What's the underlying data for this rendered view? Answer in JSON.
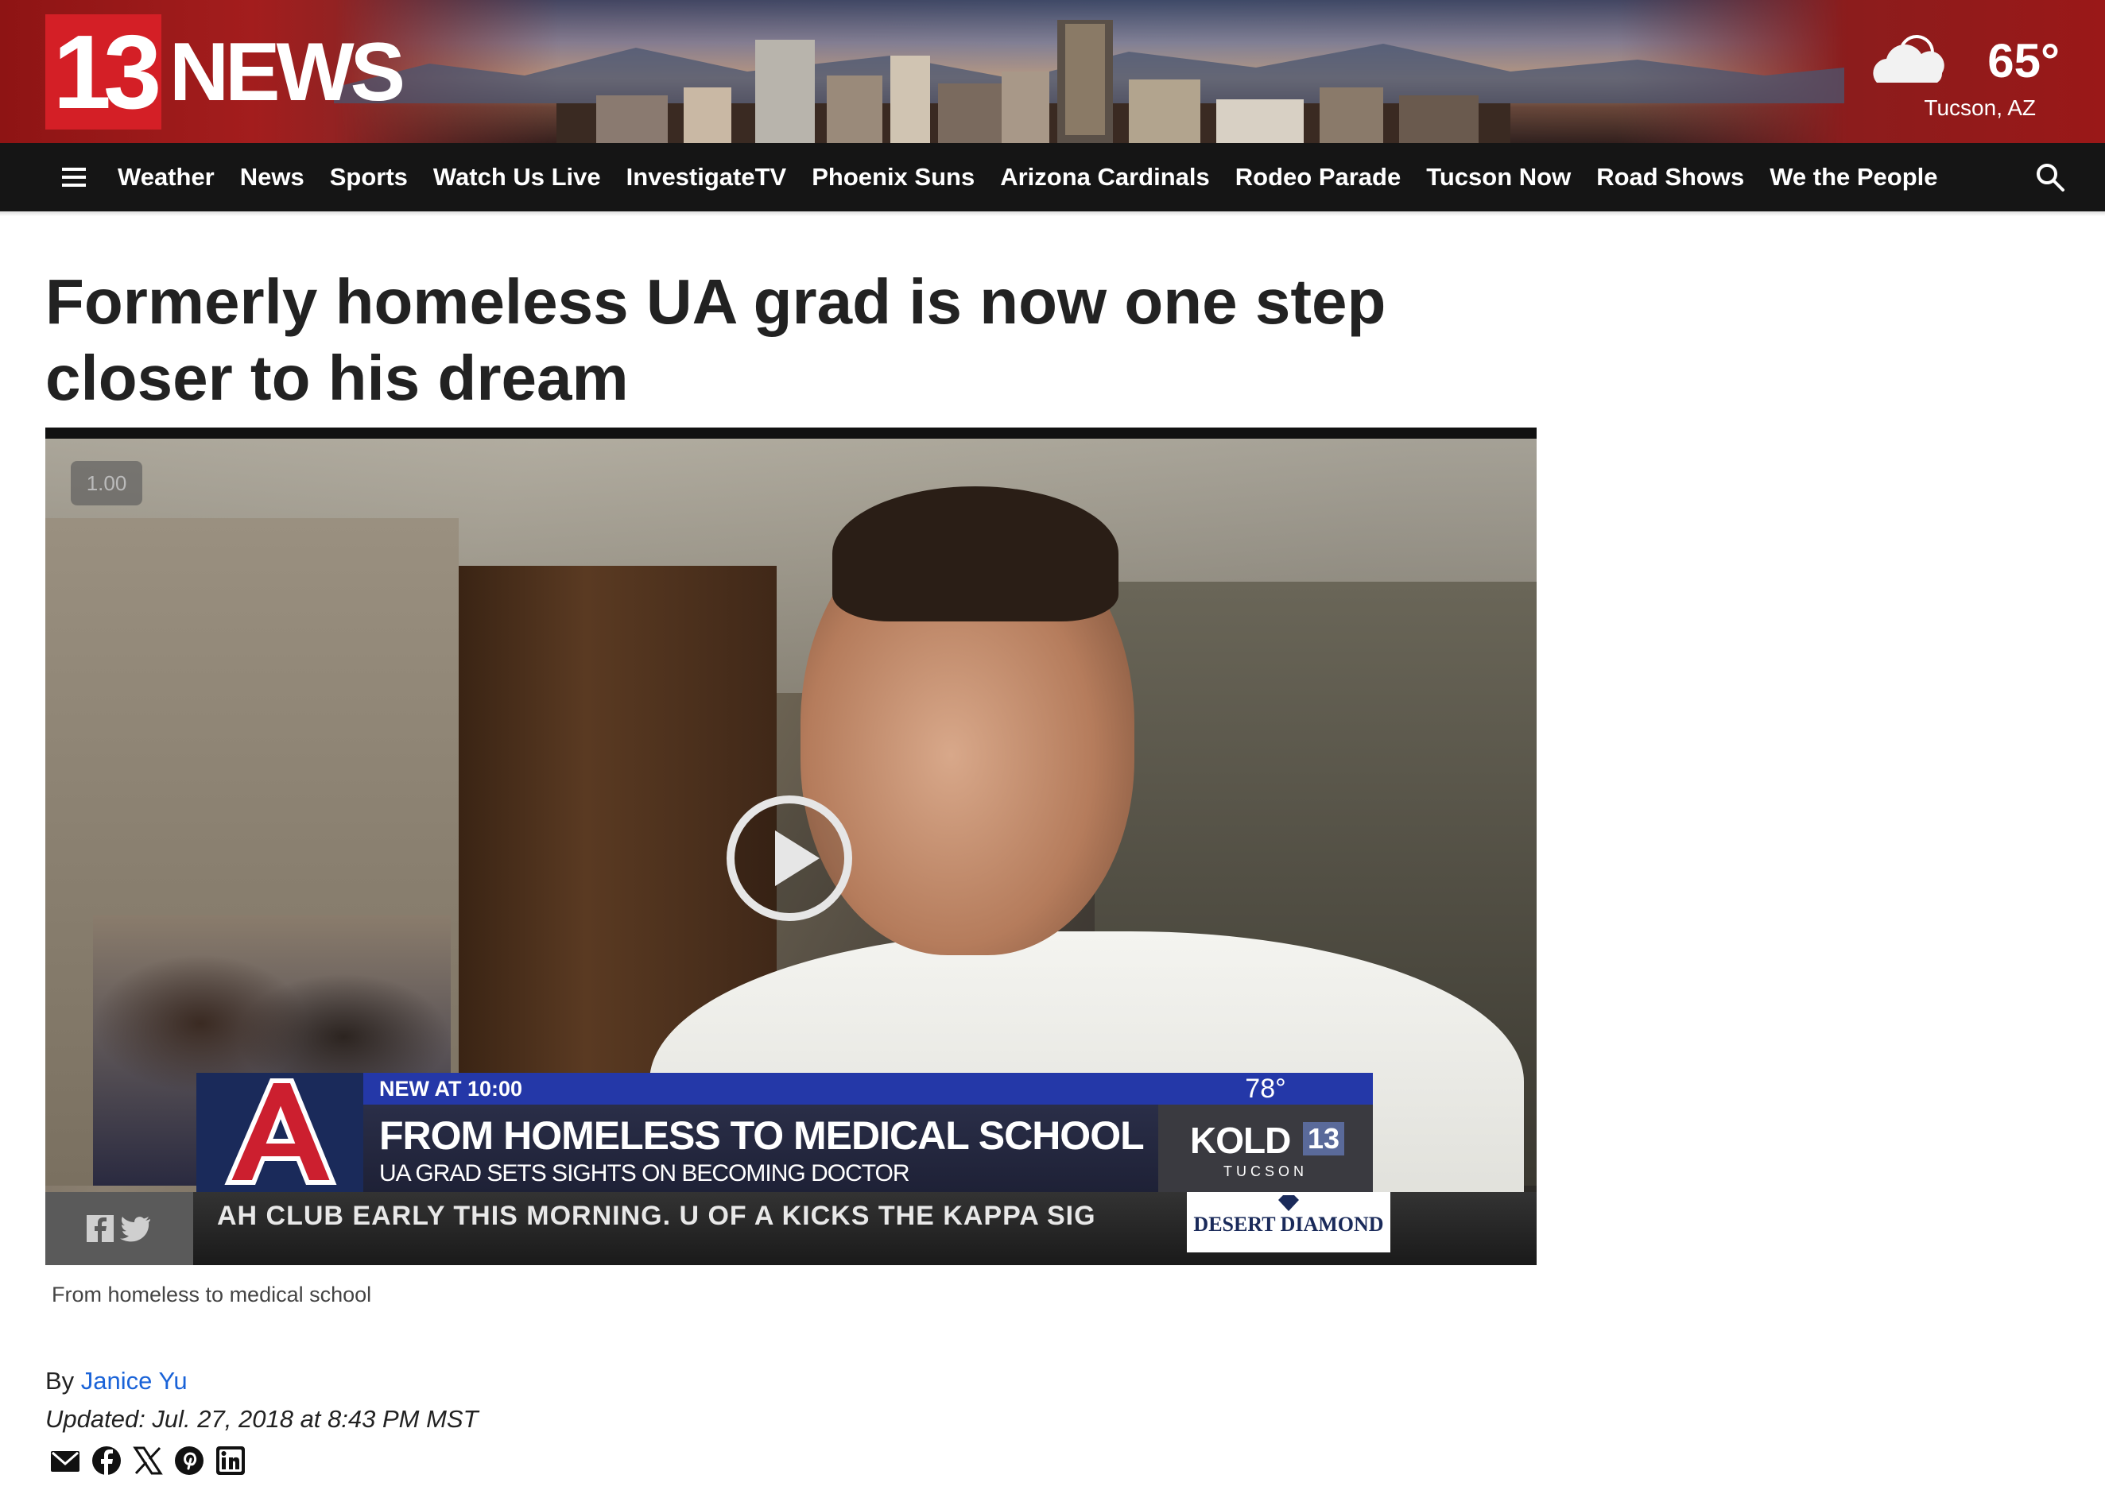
{
  "header": {
    "logo_number": "13",
    "logo_word": "NEWS",
    "weather": {
      "temperature": "65°",
      "location": "Tucson, AZ",
      "icon": "partly-cloudy-icon"
    }
  },
  "nav": {
    "menu_icon": "hamburger-menu-icon",
    "items": [
      "Weather",
      "News",
      "Sports",
      "Watch Us Live",
      "InvestigateTV",
      "Phoenix Suns",
      "Arizona Cardinals",
      "Rodeo Parade",
      "Tucson Now",
      "Road Shows",
      "We the People"
    ],
    "search_icon": "search-icon"
  },
  "article": {
    "headline": "Formerly homeless UA grad is now one step closer to his dream",
    "video": {
      "speed": "1.00",
      "play_icon": "play-icon",
      "lower_third": {
        "kicker": "NEW AT 10:00",
        "title": "FROM HOMELESS TO MEDICAL SCHOOL",
        "subtitle": "UA GRAD SETS SIGHTS ON BECOMING DOCTOR",
        "temperature": "78°",
        "station": "KOLD",
        "station_number": "13",
        "station_city": "TUCSON"
      },
      "ticker": "AH CLUB EARLY THIS MORNING.   U OF A KICKS THE KAPPA SIG",
      "sponsor": "DESERT DIAMOND"
    },
    "caption": "From homeless to medical school",
    "byline_prefix": "By ",
    "author": "Janice Yu",
    "updated": "Updated: Jul. 27, 2018 at 8:43 PM MST",
    "share_icons": [
      "email-icon",
      "facebook-icon",
      "x-icon",
      "pinterest-icon",
      "linkedin-icon"
    ]
  },
  "colors": {
    "brand_red": "#d41f26",
    "nav_bg": "#151515",
    "link_blue": "#1a63d8",
    "lower_third_blue": "#2438a8"
  }
}
